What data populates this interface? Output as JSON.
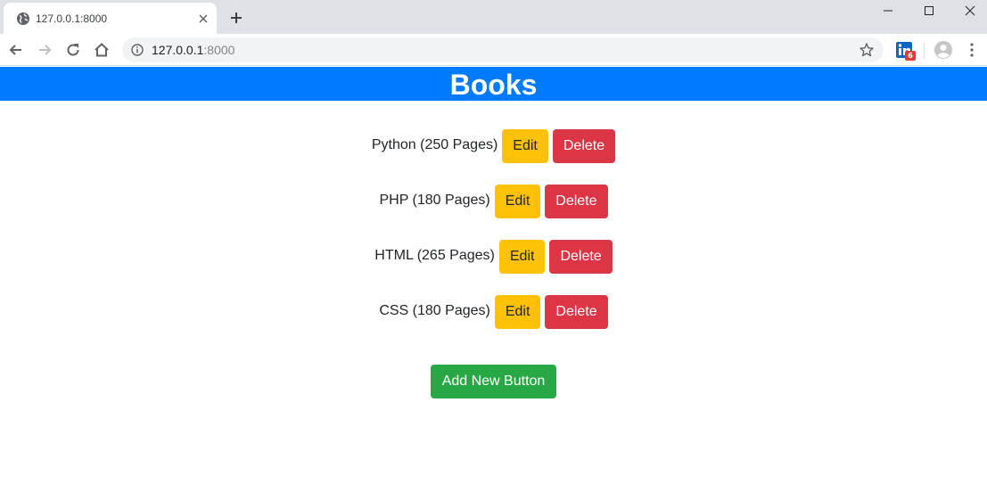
{
  "browser": {
    "tab_title": "127.0.0.1:8000",
    "url_host": "127.0.0.1",
    "url_port": ":8000",
    "extension_badge": "6"
  },
  "page": {
    "title": "Books",
    "books": [
      {
        "name": "Python (250 Pages)",
        "edit_label": "Edit",
        "delete_label": "Delete"
      },
      {
        "name": "PHP (180 Pages)",
        "edit_label": "Edit",
        "delete_label": "Delete"
      },
      {
        "name": "HTML (265 Pages)",
        "edit_label": "Edit",
        "delete_label": "Delete"
      },
      {
        "name": "CSS (180 Pages)",
        "edit_label": "Edit",
        "delete_label": "Delete"
      }
    ],
    "add_button_label": "Add New Button"
  },
  "colors": {
    "header": "#007bff",
    "edit": "#ffc107",
    "delete": "#dc3545",
    "add": "#28a745"
  }
}
